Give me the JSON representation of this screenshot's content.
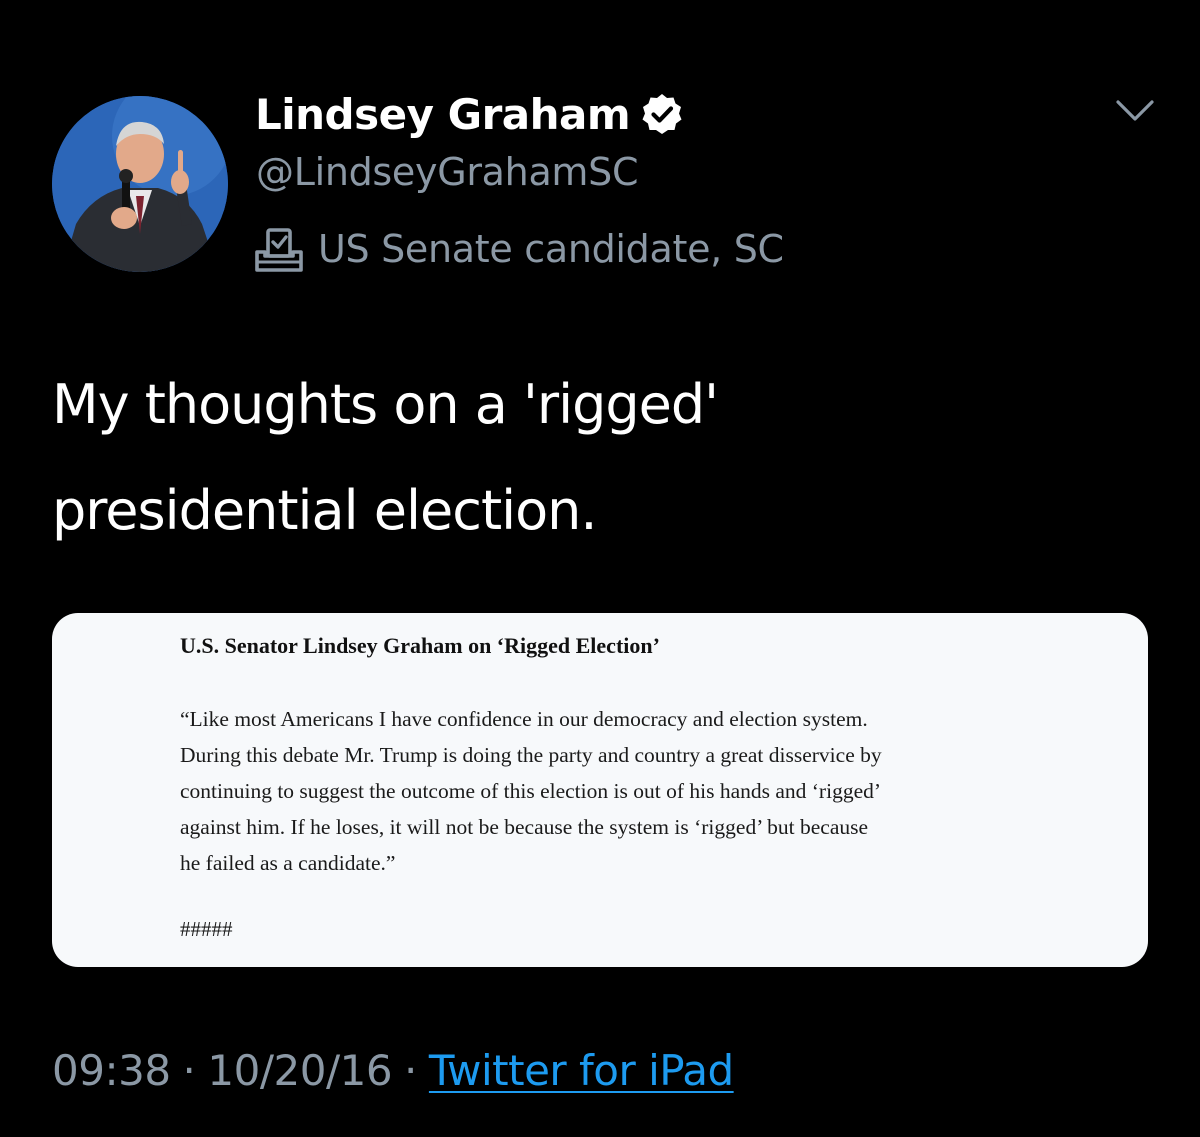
{
  "author": {
    "display_name": "Lindsey Graham",
    "handle": "@LindseyGrahamSC",
    "label": "US Senate candidate, SC",
    "avatar_icon": "person-with-microphone-photo",
    "verified_icon": "verified-badge-icon",
    "label_icon": "ballot-box-icon"
  },
  "menu": {
    "icon": "chevron-down-icon"
  },
  "tweet": {
    "text": "My thoughts on a 'rigged'\npresidential election."
  },
  "attachment": {
    "title": "U.S. Senator Lindsey Graham on ‘Rigged Election’",
    "body_lines": [
      "“Like most Americans I have confidence in our democracy and election system.",
      "During this debate Mr. Trump is doing the party and country a great disservice by",
      "continuing to suggest the outcome of this election is out of his hands and ‘rigged’",
      "against him.  If he loses, it will not be because the system is ‘rigged’ but because",
      "he failed as a candidate.”"
    ],
    "end_mark": "#####"
  },
  "meta": {
    "time": "09:38",
    "separator": "·",
    "date": "10/20/16",
    "source": "Twitter for iPad"
  },
  "colors": {
    "background": "#000000",
    "secondary_text": "#8b98a5",
    "link": "#1d9bf0",
    "card_background": "#f7f9fb"
  }
}
